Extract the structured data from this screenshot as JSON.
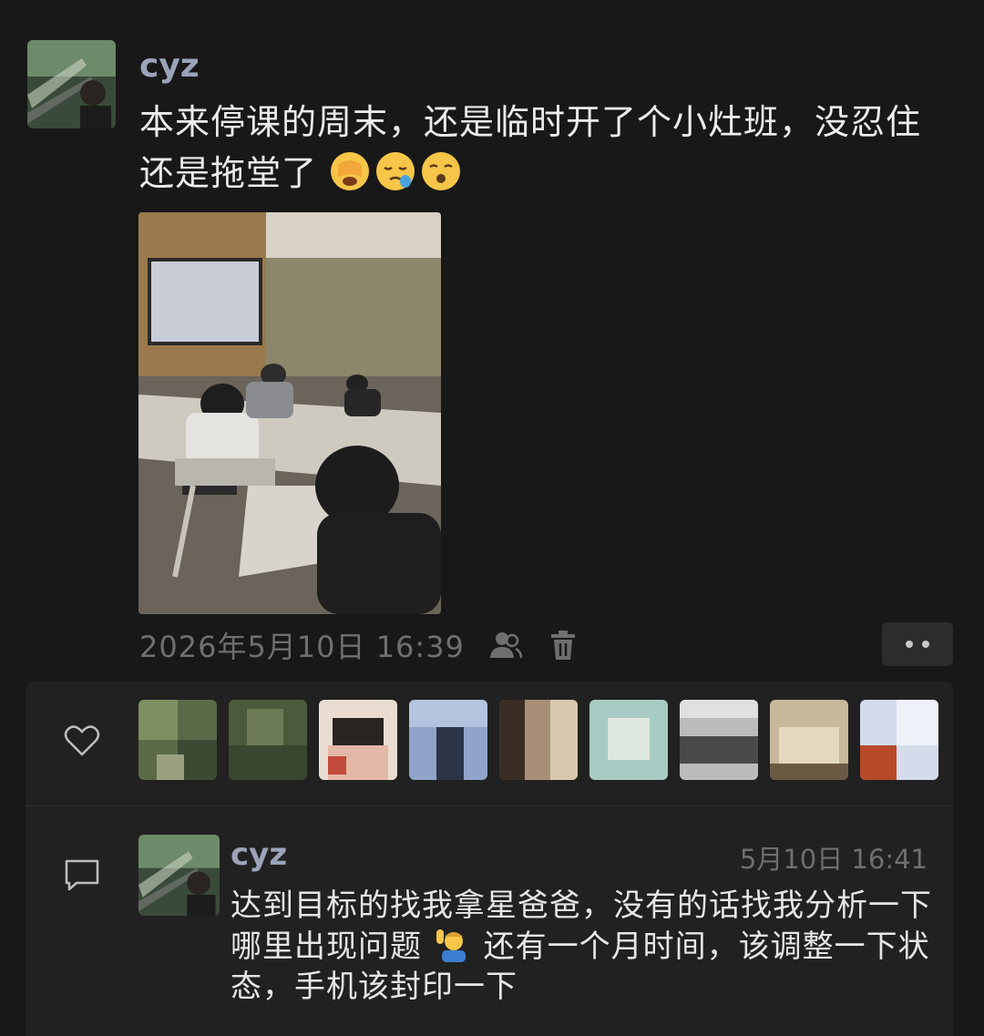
{
  "post": {
    "username": "cyz",
    "text_before_emoji": "本来停课的周末，还是临时开了个小灶班，没忍住还是拖堂了",
    "emojis": [
      "facepalm-emoji",
      "sleepy-emoji",
      "sigh-emoji"
    ],
    "timestamp": "2026年5月10日 16:39",
    "visibility_icon": "people-icon",
    "delete_icon": "trash-icon",
    "more_icon": "more-dots-icon"
  },
  "likes": {
    "icon": "heart-icon",
    "count_shown": 9
  },
  "comment": {
    "icon": "comment-bubble-icon",
    "username": "cyz",
    "timestamp": "5月10日 16:41",
    "text_part1": "达到目标的找我拿星爸爸，没有的话找我分析一下哪里出现问题",
    "emoji": "raising-hand-emoji",
    "text_part2": "还有一个月时间，该调整一下状态，手机该封印一下"
  },
  "colors": {
    "background": "#181818",
    "panel": "#212121",
    "username": "#9aa3b8",
    "meta": "#6f6f6f"
  }
}
